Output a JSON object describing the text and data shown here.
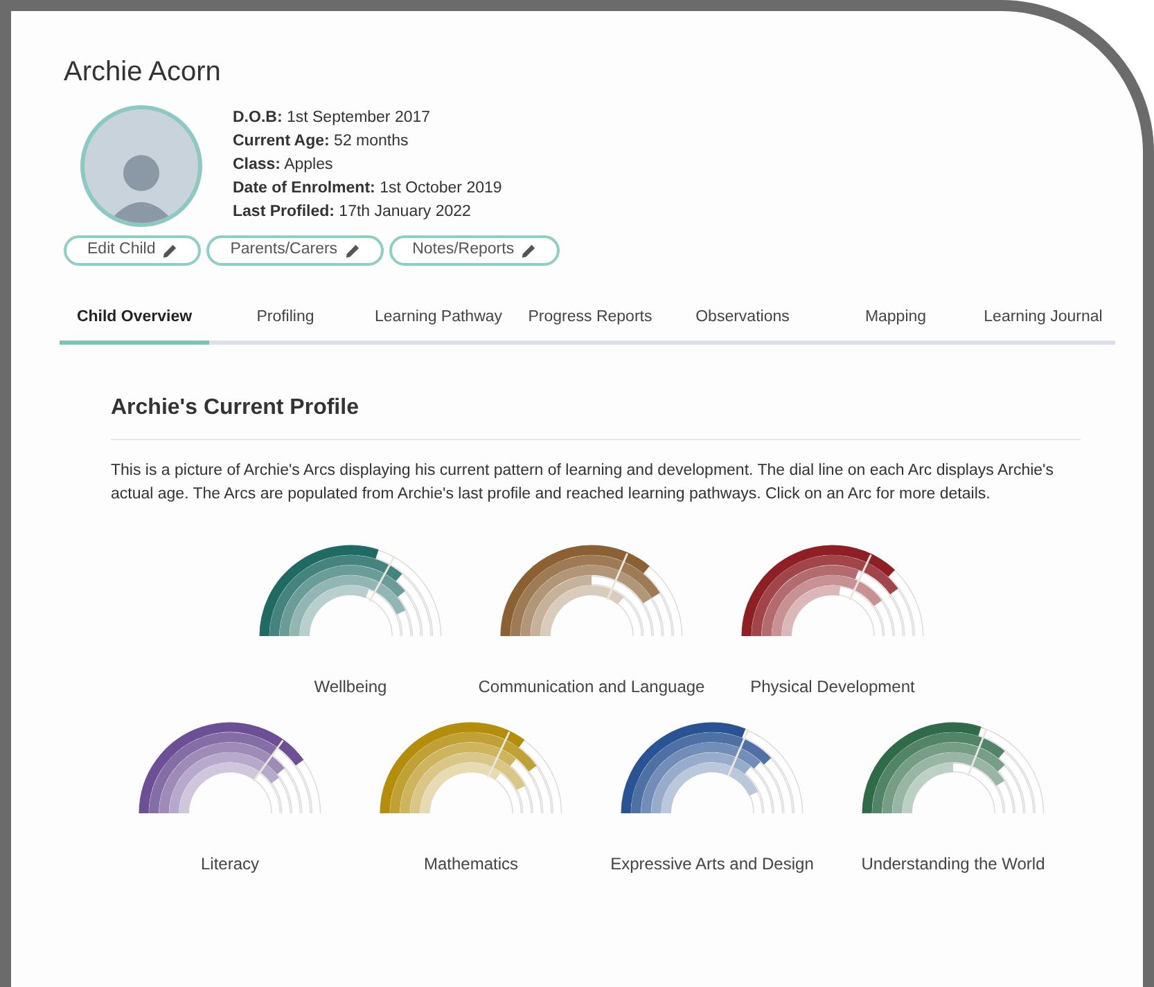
{
  "child": {
    "name": "Archie Acorn",
    "details": [
      {
        "label": "D.O.B:",
        "value": "1st September 2017"
      },
      {
        "label": "Current Age:",
        "value": "52 months"
      },
      {
        "label": "Class:",
        "value": "Apples"
      },
      {
        "label": "Date of Enrolment:",
        "value": "1st October 2019"
      },
      {
        "label": "Last Profiled:",
        "value": "17th January 2022"
      }
    ],
    "buttons": [
      "Edit Child",
      "Parents/Carers",
      "Notes/Reports"
    ]
  },
  "tabs": [
    {
      "label": "Child Overview",
      "selected": true
    },
    {
      "label": "Profiling",
      "selected": false
    },
    {
      "label": "Learning Pathway",
      "selected": false
    },
    {
      "label": "Progress Reports",
      "selected": false
    },
    {
      "label": "Observations",
      "selected": false
    },
    {
      "label": "Mapping",
      "selected": false
    },
    {
      "label": "Learning Journal",
      "selected": false
    }
  ],
  "profile": {
    "title": "Archie's Current Profile",
    "description": "This is a picture of Archie's Arcs displaying his current pattern of learning and development. The dial line on each Arc displays Archie's actual age. The Arcs are populated from Archie's last profile and reached learning pathways. Click on an Arc for more details.",
    "arc_rows": [
      [
        {
          "label": "Wellbeing",
          "color": "#1f6b63"
        },
        {
          "label": "Communication and Language",
          "color": "#8b6032"
        },
        {
          "label": "Physical Development",
          "color": "#8e1f25"
        }
      ],
      [
        {
          "label": "Literacy",
          "color": "#6c4f94"
        },
        {
          "label": "Mathematics",
          "color": "#b48d0a"
        },
        {
          "label": "Expressive Arts and Design",
          "color": "#2a5393"
        },
        {
          "label": "Understanding the World",
          "color": "#2f6b48"
        }
      ]
    ]
  }
}
